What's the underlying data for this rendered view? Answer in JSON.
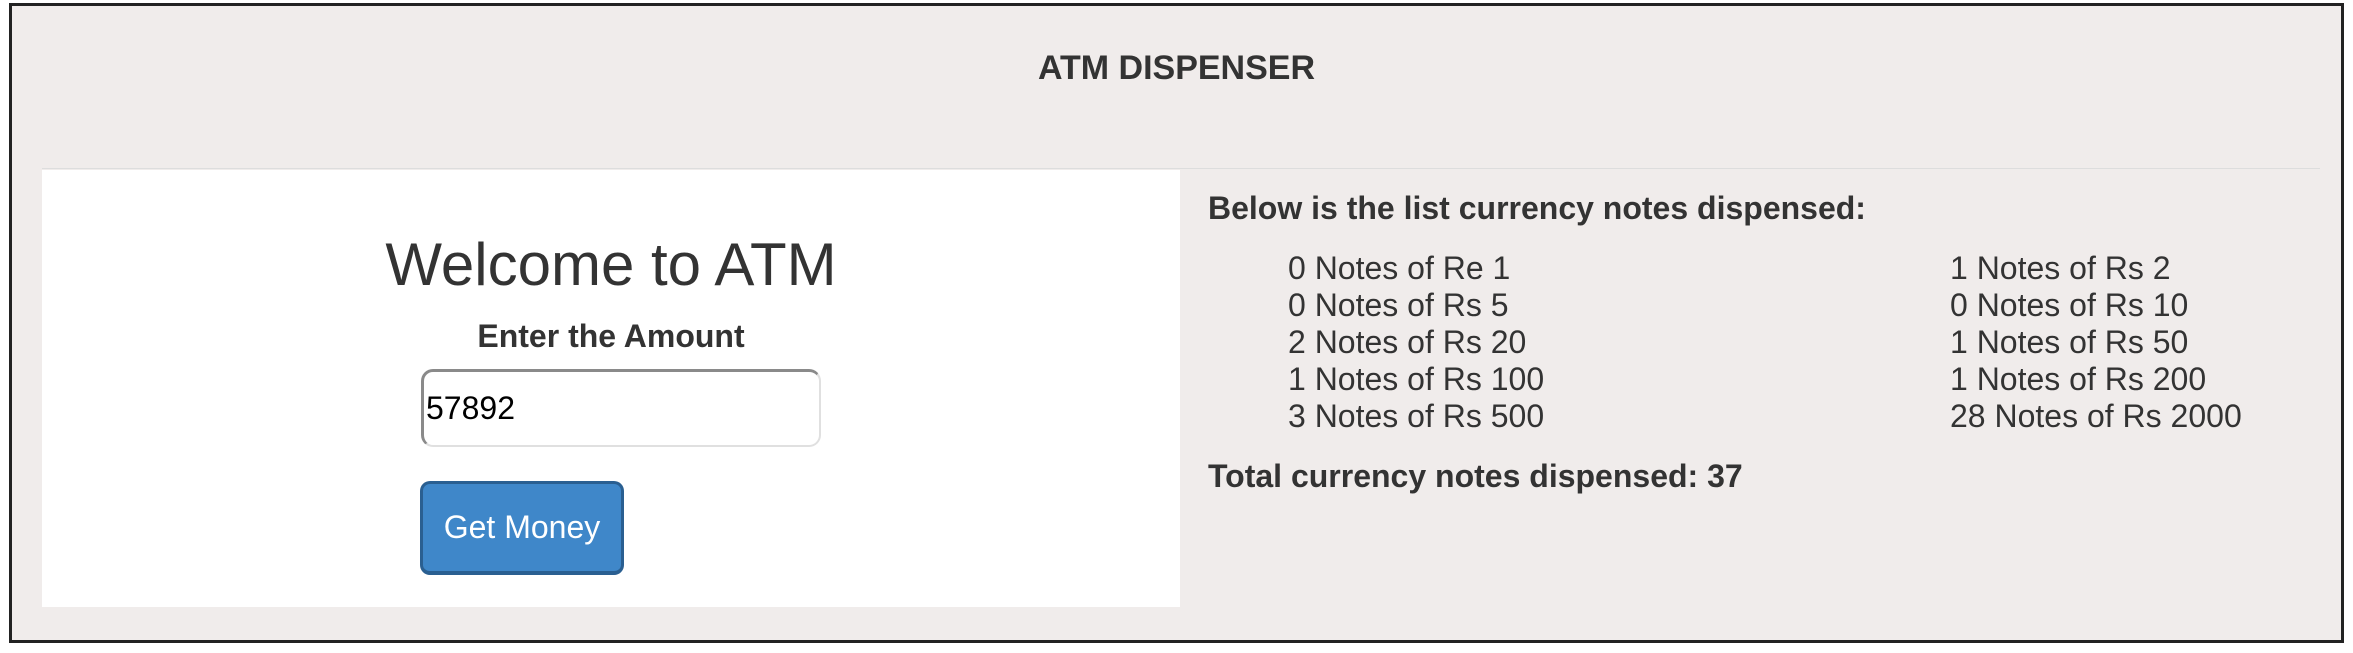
{
  "app": {
    "title": "ATM DISPENSER"
  },
  "form": {
    "welcome": "Welcome to ATM",
    "amount_label": "Enter the Amount",
    "amount_value": "57892",
    "button_label": "Get Money"
  },
  "results": {
    "heading": "Below is the list currency notes dispensed:",
    "notes": [
      "0 Notes of Re 1",
      "1 Notes of Rs 2",
      "0 Notes of Rs 5",
      "0 Notes of Rs 10",
      "2 Notes of Rs 20",
      "1 Notes of Rs 50",
      "1 Notes of Rs 100",
      "1 Notes of Rs 200",
      "3 Notes of Rs 500",
      "28 Notes of Rs 2000"
    ],
    "total": "Total currency notes dispensed: 37"
  },
  "colors": {
    "background": "#f0eceb",
    "panel": "#ffffff",
    "button": "#3f87c9",
    "text": "#333333"
  }
}
